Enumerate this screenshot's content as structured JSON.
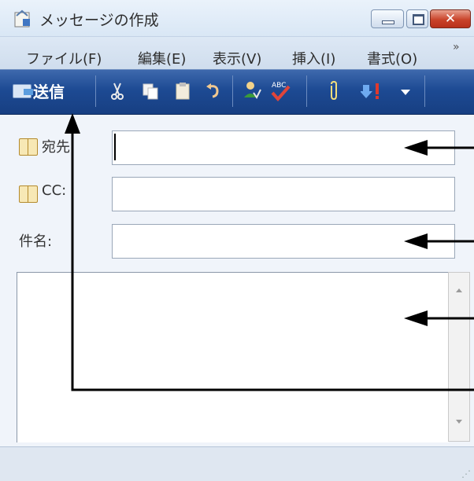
{
  "window": {
    "title": "メッセージの作成",
    "close_glyph": "✕"
  },
  "menu": {
    "items": [
      {
        "label": "ファイル(F)"
      },
      {
        "label": "編集(E)"
      },
      {
        "label": "表示(V)"
      },
      {
        "label": "挿入(I)"
      },
      {
        "label": "書式(O)"
      }
    ],
    "overflow_glyph": "»"
  },
  "toolbar": {
    "send_label": "送信",
    "icons": [
      "cut-icon",
      "copy-icon",
      "paste-icon",
      "undo-icon",
      "check-names-icon",
      "spelling-icon",
      "attach-icon",
      "priority-icon",
      "dropdown-icon"
    ]
  },
  "fields": {
    "to_label": "宛先:",
    "cc_label": "CC:",
    "subject_label": "件名:"
  },
  "colors": {
    "toolbar_bg": "#1d4a93",
    "close_button": "#c9432a",
    "arrow": "#000000"
  }
}
